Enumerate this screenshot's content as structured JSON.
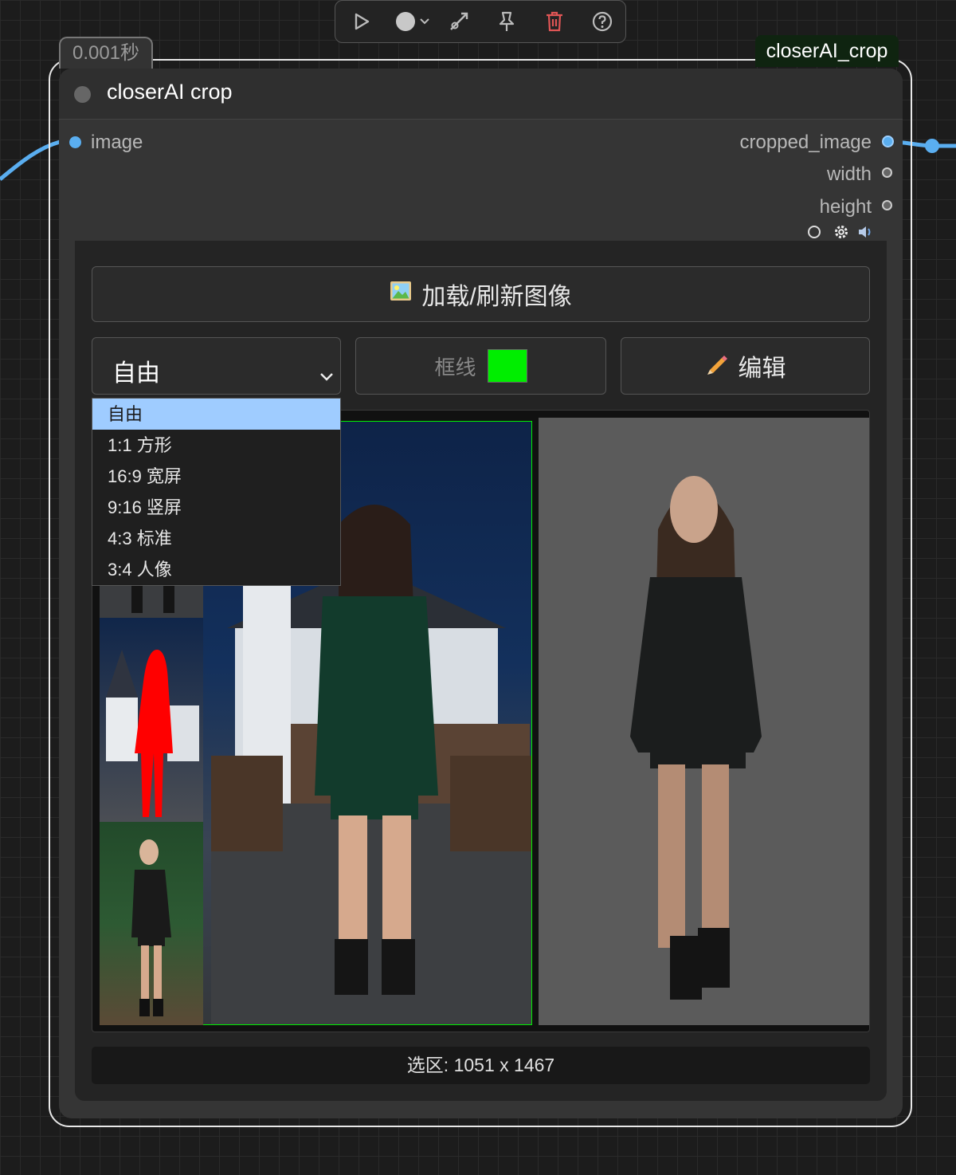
{
  "toolbar": {
    "icons": [
      "play-icon",
      "record-dot-icon",
      "link-icon",
      "pin-icon",
      "trash-icon",
      "help-icon"
    ],
    "trash_color": "#e05555"
  },
  "node": {
    "exec_time": "0.001秒",
    "id": "closerAI_crop",
    "title": "closerAI crop",
    "input": "image",
    "outputs": [
      "cropped_image",
      "width",
      "height"
    ],
    "link_color": "#5aaef0",
    "id_badge_color": "#0f2410",
    "header_icons": [
      "circle-icon",
      "gear-icon",
      "speaker-icon"
    ]
  },
  "widget": {
    "load_button": "加载/刷新图像",
    "ratio_select": {
      "value": "自由",
      "options": [
        "自由",
        "1:1 方形",
        "16:9 宽屏",
        "9:16 竖屏",
        "4:3 标准",
        "3:4 人像"
      ]
    },
    "frame_label": "框线",
    "frame_color": "#00ee00",
    "edit_button": "编辑",
    "status": "选区: 1051 x 1467"
  }
}
